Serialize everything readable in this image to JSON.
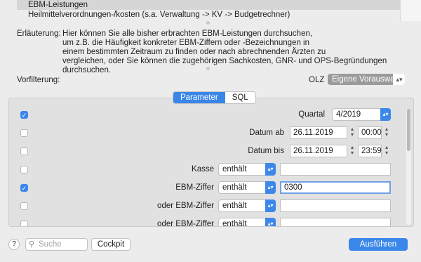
{
  "list": {
    "items": [
      "EBM-Leistungen",
      "Heilmittelverordnungen-/kosten (s.a. Verwaltung -> KV -> Budgetrechner)"
    ]
  },
  "explain": {
    "label": "Erläuterung:",
    "text": "Hier können Sie alle bisher erbrachten EBM-Leistungen durchsuchen,\num z.B. die Häufigkeit konkreter EBM-Ziffern oder -Bezeichnungen in\neinem bestimmten Zeitraum zu finden oder nach abrechnenden Ärzten zu\nvergleichen, oder Sie können die zugehörigen Sachkosten, GNR- und OPS-Begründungen durchsuchen."
  },
  "filter": {
    "label": "Vorfilterung:",
    "olz_label": "OLZ",
    "olz_value": "Eigene Vorauswahl"
  },
  "tabs": [
    "Parameter",
    "SQL"
  ],
  "rows": [
    {
      "checked": true,
      "label": "Quartal",
      "value": "4/2019"
    },
    {
      "checked": false,
      "label": "Datum ab",
      "date": "26.11.2019",
      "time": "00:00"
    },
    {
      "checked": false,
      "label": "Datum bis",
      "date": "26.11.2019",
      "time": "23:59"
    },
    {
      "checked": false,
      "label": "Kasse",
      "op": "enthält",
      "value": ""
    },
    {
      "checked": true,
      "label": "EBM-Ziffer",
      "op": "enthält",
      "value": "0300"
    },
    {
      "checked": false,
      "label": "oder EBM-Ziffer",
      "op": "enthält",
      "value": ""
    },
    {
      "checked": false,
      "label": "oder EBM-Ziffer",
      "op": "enthält",
      "value": ""
    }
  ],
  "bottom": {
    "help": "?",
    "search_placeholder": "Suche",
    "cockpit": "Cockpit",
    "run": "Ausführen"
  }
}
